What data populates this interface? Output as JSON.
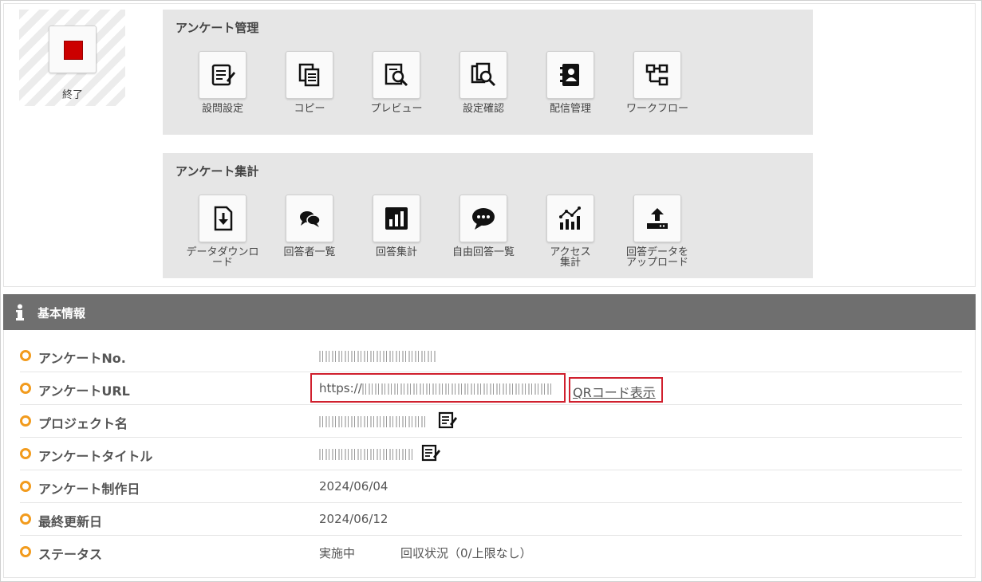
{
  "stop": {
    "label": "終了"
  },
  "survey_management": {
    "title": "アンケート管理",
    "tools": [
      {
        "label": "設問設定",
        "icon": "question-settings-icon"
      },
      {
        "label": "コピー",
        "icon": "copy-icon"
      },
      {
        "label": "プレビュー",
        "icon": "preview-icon"
      },
      {
        "label": "設定確認",
        "icon": "settings-check-icon"
      },
      {
        "label": "配信管理",
        "icon": "delivery-icon"
      },
      {
        "label": "ワークフロー",
        "icon": "workflow-icon"
      }
    ]
  },
  "survey_aggregation": {
    "title": "アンケート集計",
    "tools": [
      {
        "label1": "データダウンロ",
        "label2": "ード",
        "icon": "download-icon"
      },
      {
        "label1": "回答者一覧",
        "label2": "",
        "icon": "respondents-icon"
      },
      {
        "label1": "回答集計",
        "label2": "",
        "icon": "bar-chart-icon"
      },
      {
        "label1": "自由回答一覧",
        "label2": "",
        "icon": "speech-bubble-icon"
      },
      {
        "label1": "アクセス",
        "label2": "集計",
        "icon": "access-chart-icon"
      },
      {
        "label1": "回答データを",
        "label2": "アップロード",
        "icon": "upload-icon"
      }
    ]
  },
  "basic_info": {
    "title": "基本情報",
    "rows": [
      {
        "key": "アンケートNo."
      },
      {
        "key": "アンケートURL",
        "value_prefix": "https://",
        "qr_link": "QRコード表示"
      },
      {
        "key": "プロジェクト名"
      },
      {
        "key": "アンケートタイトル"
      },
      {
        "key": "アンケート制作日",
        "value": "2024/06/04"
      },
      {
        "key": "最終更新日",
        "value": "2024/06/12"
      },
      {
        "key": "ステータス",
        "value": "実施中",
        "extra": "回収状況（0/上限なし）"
      }
    ]
  },
  "colors": {
    "accent_orange": "#f29b1d",
    "highlight_red": "#d0202e",
    "header_gray": "#6f6f6f",
    "stop_red": "#cc0000"
  }
}
